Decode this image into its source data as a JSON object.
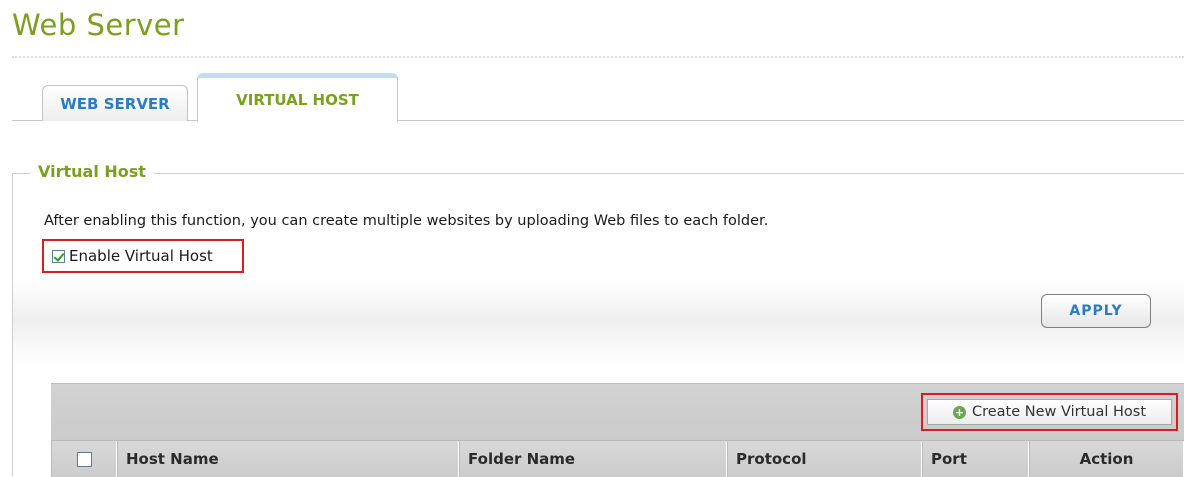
{
  "page": {
    "title": "Web Server"
  },
  "tabs": [
    {
      "label": "WEB SERVER",
      "active": false
    },
    {
      "label": "VIRTUAL HOST",
      "active": true
    }
  ],
  "section": {
    "legend": "Virtual Host",
    "description": "After enabling this function, you can create multiple websites by uploading Web files to each folder.",
    "enable_label": "Enable Virtual Host",
    "enable_checked": true,
    "apply_label": "APPLY",
    "create_label": "Create New Virtual Host",
    "create_icon": "plus-circle-icon"
  },
  "table": {
    "columns": [
      "Host Name",
      "Folder Name",
      "Protocol",
      "Port",
      "Action"
    ]
  },
  "colors": {
    "title_green": "#7aa020",
    "tab_blue": "#2a7dc4",
    "highlight_red": "#d42020"
  }
}
